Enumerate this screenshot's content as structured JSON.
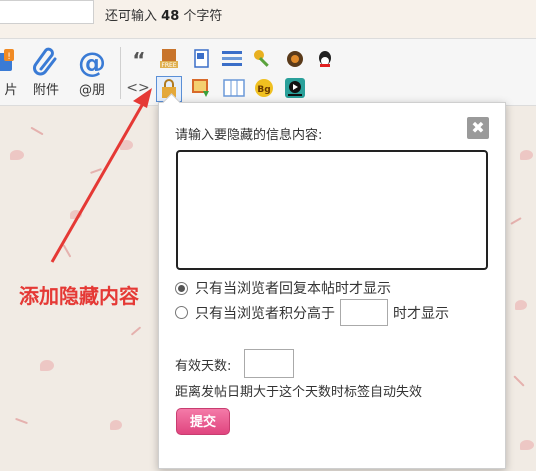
{
  "title_bar": {
    "char_count_prefix": "还可输入",
    "char_count_value": "48",
    "char_count_suffix": "个字符"
  },
  "toolbar": {
    "image_label": "片",
    "attachment_label": "附件",
    "mention_label": "@朋",
    "quote_glyph": "“",
    "code_glyph": "<>",
    "small_tools": [
      "quote-icon",
      "free-icon",
      "word-icon",
      "list-icon",
      "key-icon",
      "disc-icon",
      "qq-icon",
      "code-icon",
      "hide-content-icon",
      "image-insert-icon",
      "table-icon",
      "bg-icon",
      "video-icon"
    ]
  },
  "popup": {
    "label": "请输入要隐藏的信息内容:",
    "close_glyph": "✖",
    "content_value": "",
    "option_reply": "只有当浏览者回复本帖时才显示",
    "option_score_prefix": "只有当浏览者积分高于",
    "option_score_suffix": "时才显示",
    "score_value": "",
    "days_label": "有效天数:",
    "days_value": "",
    "hint": "距离发帖日期大于这个天数时标签自动失效",
    "submit_label": "提交"
  },
  "annotation": {
    "text": "添加隐藏内容",
    "color": "#e53935"
  }
}
